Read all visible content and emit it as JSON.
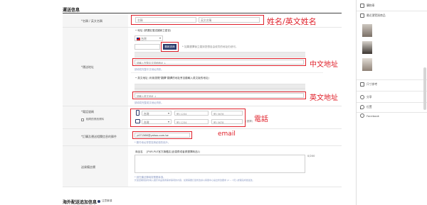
{
  "section_title": "運送信息",
  "form": {
    "name": {
      "label": "*名稱 / 英文名稱",
      "placeholder_first": "名稱",
      "placeholder_last": "英文名稱"
    },
    "address": {
      "label": "*運送地址",
      "cn_title": "• 地址 (請選定運送國家之語言)",
      "country_value": "台灣",
      "country_flag": "flag-tw",
      "lookup_button": "郵政查詢",
      "lookup_note": "* 如果選擇後立運到您想自由收貨的地址仍然可。",
      "cn_detail_placeholder": "請輸入完整中文詳細地址 ↓",
      "cn_hint": "請填寫完整中文地址資訊。",
      "en_title": "• 英文地址 (利用瀏覽\"翻譯\"翻譯的地址會自動輸入英文版的地址)",
      "en_detail_placeholder": "請輸入英文地址 ↓",
      "en_hint": "請填寫完整英文地址資訊。"
    },
    "phone": {
      "label": "*電話號碼",
      "same_checkbox_label": "相同的資訊資料",
      "mobile_country": "台灣",
      "mobile_mid": "例) 1234",
      "mobile_last": "例) 5678",
      "tel_country": "台灣",
      "tel_mid": "例) 1234",
      "tel_last": "例) 5678",
      "tel_tag": "(選擇)"
    },
    "email": {
      "label": "*訂購及運送相關信息的郵件",
      "value": "y471566@yahoo.com.tw",
      "hint": "* 郵件地址會是查詢紀錄的用戶。"
    },
    "memo": {
      "label": "送貨備註欄",
      "product_prefix": "商品名",
      "product_desc": "[PUR-PLE官方旗艦店]含運費或者請選擇商品1)",
      "counter": "0/200",
      "note_line1": "* 請在備註欄填寫需要事項。",
      "note_line2": "  於運送期間請勿填入關於商品或者需求事項的內容，如果需要訂單修改請以客服中心提出修改要求 (2 ~ 3天) 處理完成後運送。"
    }
  },
  "overseas_title": "海外配送追加信息",
  "overseas_tag": "注意事項",
  "annotations": {
    "name": "姓名/英文姓名",
    "cn_address": "中文地址",
    "en_address": "英文地址",
    "phone": "電話",
    "email": "email"
  },
  "sidebar": {
    "items": [
      {
        "label": "購物車",
        "icon": "cart-icon"
      },
      {
        "label": "最近瀏覽過商品",
        "icon": "recent-icon"
      },
      {
        "label": "尺寸參考",
        "icon": "size-icon"
      },
      {
        "label": "分享",
        "icon": "share-icon"
      },
      {
        "label": "位置",
        "icon": "location-icon"
      },
      {
        "label": "Facebook",
        "icon": "facebook-icon"
      }
    ]
  },
  "colors": {
    "annotation_red": "#e0202a",
    "link_blue": "#8c9bc4",
    "lookup_button_bg": "#2a3a6b"
  }
}
